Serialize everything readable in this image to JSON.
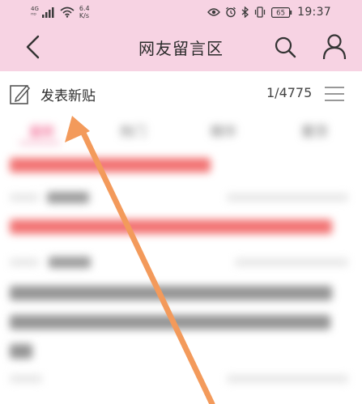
{
  "status_bar": {
    "network_type_top": "4G",
    "network_type_bottom": "ᴴᴰ",
    "speed_value": "6.4",
    "speed_unit": "K/s",
    "battery": "65",
    "time": "19:37",
    "icons": [
      "signal-icon",
      "wifi-icon",
      "eye-icon",
      "alarm-icon",
      "bluetooth-icon",
      "vibrate-icon",
      "battery-icon"
    ]
  },
  "header": {
    "title": "网友留言区",
    "icons": [
      "back-arrow-icon",
      "search-icon",
      "user-icon"
    ]
  },
  "toolbar": {
    "post_label": "发表新贴",
    "page_count": "1/4775",
    "icons": [
      "edit-icon",
      "menu-icon"
    ]
  },
  "tabs": [
    {
      "label": "最新",
      "active": true
    },
    {
      "label": "热门",
      "active": false
    },
    {
      "label": "精华",
      "active": false
    },
    {
      "label": "置顶",
      "active": false
    }
  ],
  "colors": {
    "header_bg": "#f7d3e3",
    "accent": "#ef4a7d",
    "arrow": "#f39a5b"
  }
}
